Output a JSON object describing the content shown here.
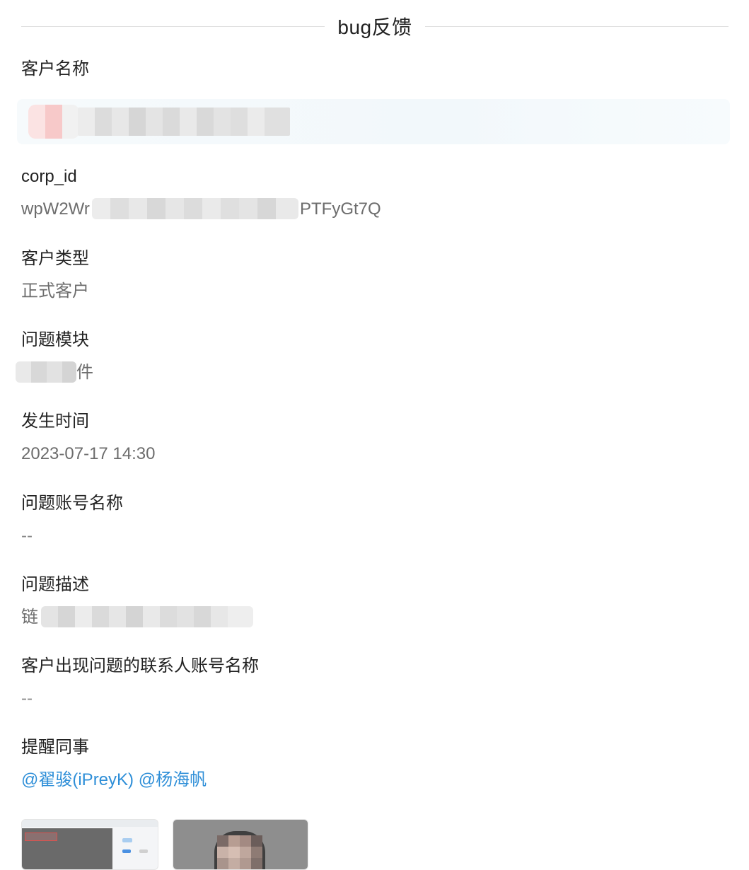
{
  "header": {
    "title": "bug反馈"
  },
  "fields": {
    "customer_name": {
      "label": "客户名称"
    },
    "corp_id": {
      "label": "corp_id",
      "prefix": "wpW2Wr",
      "suffix": "PTFyGt7Q"
    },
    "customer_type": {
      "label": "客户类型",
      "value": "正式客户"
    },
    "issue_module": {
      "label": "问题模块",
      "suffix": "件"
    },
    "occurred_time": {
      "label": "发生时间",
      "value": "2023-07-17 14:30"
    },
    "issue_account_name": {
      "label": "问题账号名称",
      "value": "--"
    },
    "issue_description": {
      "label": "问题描述",
      "prefix": "链"
    },
    "contact_account_name": {
      "label": "客户出现问题的联系人账号名称",
      "value": "--"
    },
    "remind_colleagues": {
      "label": "提醒同事",
      "mentions": [
        "@翟骏(iPreyK)",
        "@杨海帆"
      ]
    }
  },
  "colors": {
    "label": "#222222",
    "value": "#6d6d6d",
    "link": "#2f8fd8",
    "divider": "#e0e0e0"
  },
  "attachments": [
    {
      "icon": "screenshot-thumbnail-icon"
    },
    {
      "icon": "photo-thumbnail-icon"
    }
  ]
}
